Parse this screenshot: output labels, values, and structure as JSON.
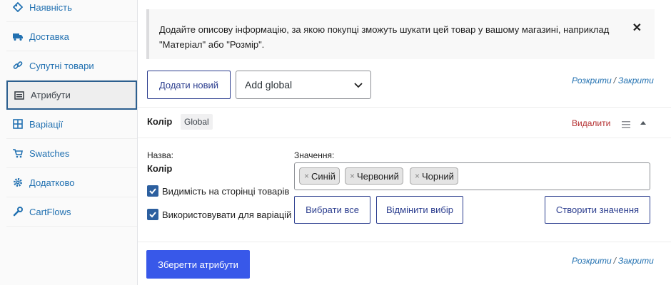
{
  "sidebar": {
    "items": [
      {
        "label": "Наявність",
        "icon": "diamond-icon"
      },
      {
        "label": "Доставка",
        "icon": "truck-icon"
      },
      {
        "label": "Супутні товари",
        "icon": "link-icon"
      },
      {
        "label": "Атрибути",
        "icon": "list-icon"
      },
      {
        "label": "Варіації",
        "icon": "grid-icon"
      },
      {
        "label": "Swatches",
        "icon": "cart-icon"
      },
      {
        "label": "Додатково",
        "icon": "gear-icon"
      },
      {
        "label": "CartFlows",
        "icon": "wrench-icon"
      }
    ],
    "active": "Атрибути"
  },
  "notice": {
    "text_line1": "Додайте описову інформацію, за якою покупці зможуть шукати цей товар у вашому магазині, наприклад",
    "text_line2": "\"Матеріал\" або \"Розмір\".",
    "close": "✕"
  },
  "toolbar": {
    "add_new_label": "Додати новий",
    "select_value": "Add global",
    "expand_label": "Розкрити",
    "separator": "/",
    "collapse_label": "Закрити"
  },
  "attribute": {
    "title": "Колір",
    "badge": "Global",
    "delete_label": "Видалити",
    "name_label": "Назва:",
    "name_value": "Колір",
    "values_label": "Значення:",
    "values": [
      "Синій",
      "Червоний",
      "Чорний"
    ],
    "visible_label": "Видимість на сторінці товарів",
    "variations_label": "Використовувати для варіацій",
    "select_all_label": "Вибрати все",
    "deselect_label": "Відмінити вибір",
    "create_value_label": "Створити значення"
  },
  "footer": {
    "save_label": "Зберегти атрибути",
    "expand_label": "Розкрити",
    "separator": "/",
    "collapse_label": "Закрити"
  },
  "colors": {
    "primary": "#3858e9",
    "link": "#2271b1",
    "delete": "#b32d2e"
  }
}
